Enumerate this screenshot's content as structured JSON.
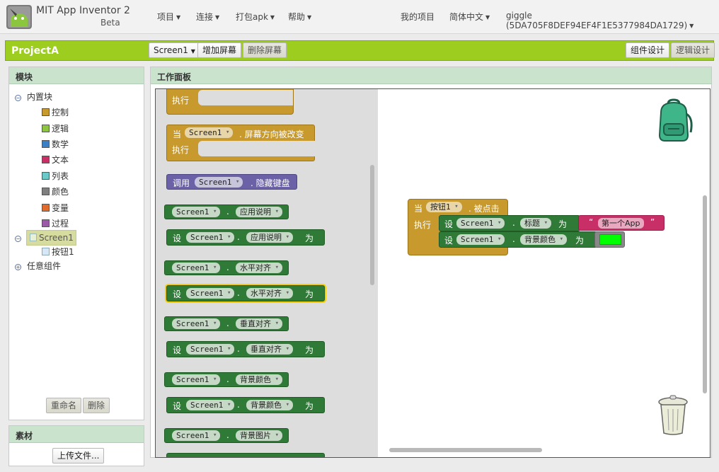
{
  "header": {
    "app_title": "MIT App Inventor 2",
    "app_subtitle": "Beta",
    "menus": [
      "项目",
      "连接",
      "打包apk",
      "帮助"
    ],
    "right_links": {
      "my_projects": "我的项目",
      "language": "简体中文",
      "user": "giggle (5DA705F8DEF94EF4F1E5377984DA1729)"
    }
  },
  "projectbar": {
    "name": "ProjectA",
    "screen_select": "Screen1",
    "add_screen": "增加屏幕",
    "remove_screen": "删除屏幕",
    "designer": "组件设计",
    "blocks": "逻辑设计"
  },
  "blocks_panel": {
    "title": "模块",
    "builtin": "内置块",
    "categories": [
      {
        "label": "控制",
        "color": "#c89a2e"
      },
      {
        "label": "逻辑",
        "color": "#8cc63f"
      },
      {
        "label": "数学",
        "color": "#3a7fc4"
      },
      {
        "label": "文本",
        "color": "#c92f67"
      },
      {
        "label": "列表",
        "color": "#6cc9c9"
      },
      {
        "label": "颜色",
        "color": "#7f7f7f"
      },
      {
        "label": "变量",
        "color": "#e06b2a"
      },
      {
        "label": "过程",
        "color": "#9c59a8"
      }
    ],
    "screen": "Screen1",
    "button": "按钮1",
    "any_component": "任意组件",
    "rename": "重命名",
    "delete": "删除"
  },
  "media_panel": {
    "title": "素材",
    "upload": "上传文件..."
  },
  "workspace": {
    "title": "工作面板",
    "flyout": {
      "do": "执行",
      "when": "当",
      "screen": "Screen1",
      "orientation_changed": ". 屏幕方向被改变",
      "call": "调用",
      "hide_keyboard": ". 隐藏键盘",
      "set": "设",
      "to": "为",
      "dot": ".",
      "props": [
        "应用说明",
        "应用说明",
        "水平对齐",
        "水平对齐",
        "垂直对齐",
        "垂直对齐",
        "背景颜色",
        "背景颜色",
        "背景图片"
      ]
    },
    "event": {
      "when": "当",
      "component": "按钮1",
      "event_name": ". 被点击",
      "do": "执行",
      "set1_prop": "标题",
      "set1_value": "第一个App",
      "set2_prop": "背景颜色",
      "color_value": "#00ff00",
      "quote_open": "“",
      "quote_close": "”"
    }
  }
}
